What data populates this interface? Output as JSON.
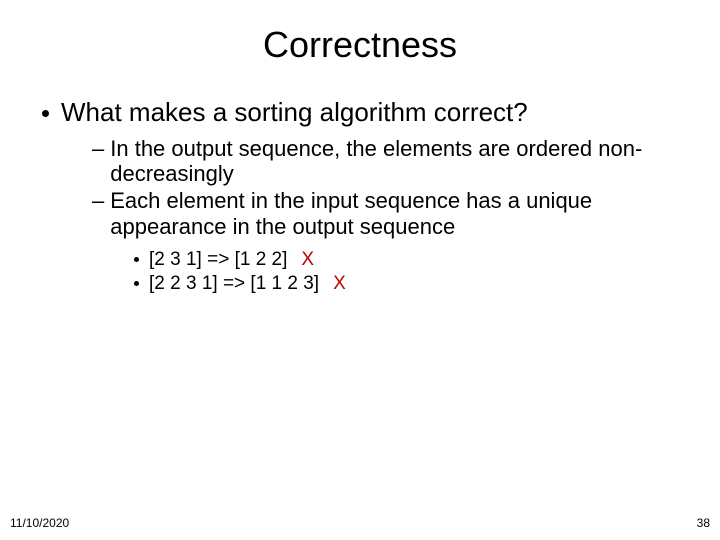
{
  "title": "Correctness",
  "bullet1": "What makes a sorting algorithm correct?",
  "sub": {
    "a": "In the output sequence, the elements are ordered non-decreasingly",
    "b": "Each element in the input sequence has a unique appearance in the output sequence"
  },
  "examples": {
    "e1_text": "[2 3 1] => [1 2 2]",
    "e1_mark": "X",
    "e2_text": "[2 2 3 1] => [1 1 2 3]",
    "e2_mark": "X"
  },
  "footer": {
    "date": "11/10/2020",
    "page": "38"
  }
}
